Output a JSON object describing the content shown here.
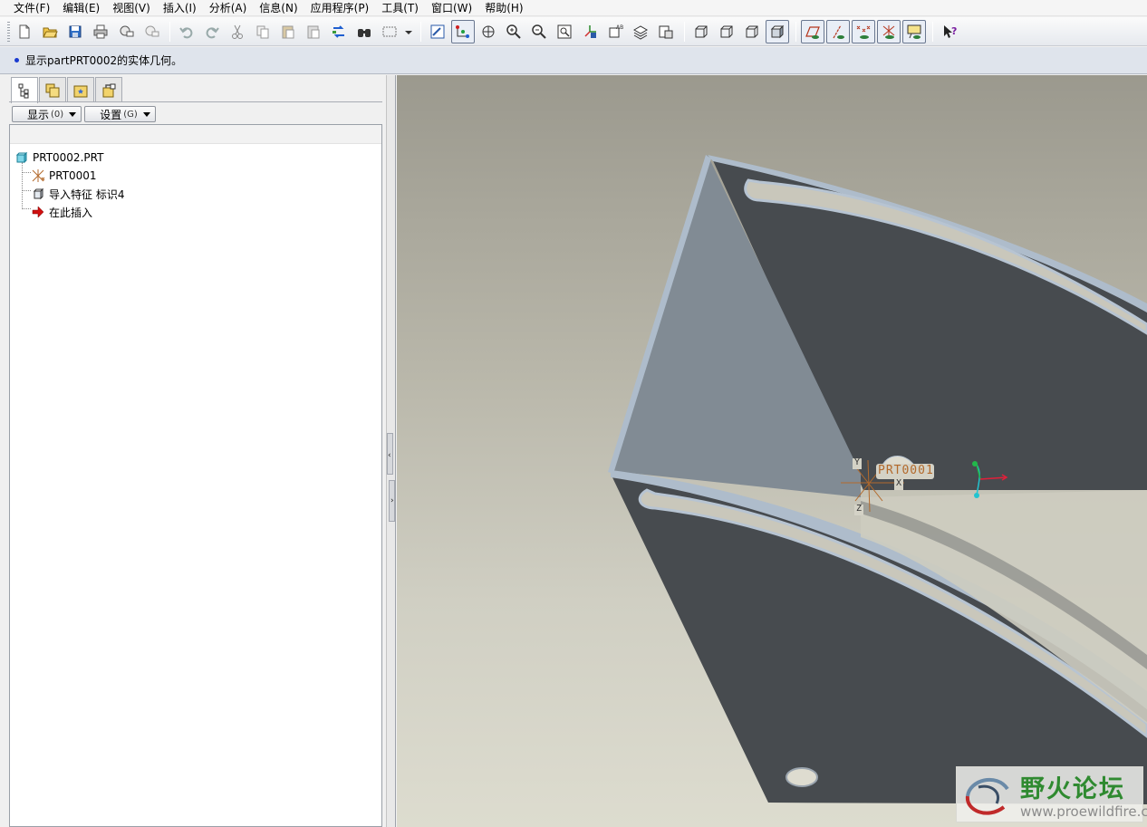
{
  "menu": {
    "items": [
      "文件(F)",
      "编辑(E)",
      "视图(V)",
      "插入(I)",
      "分析(A)",
      "信息(N)",
      "应用程序(P)",
      "工具(T)",
      "窗口(W)",
      "帮助(H)"
    ]
  },
  "toolbar": {
    "icons": [
      "new-file-icon",
      "open-folder-icon",
      "save-icon",
      "print-icon",
      "send-mail-icon",
      "mail-attach-icon",
      "undo-icon",
      "redo-icon",
      "cut-icon",
      "copy-icon",
      "paste-icon",
      "paste-special-icon",
      "regenerate-icon",
      "find-icon",
      "select-box-icon",
      "repaint-icon",
      "spin-center-icon",
      "orient-mode-icon",
      "zoom-in-icon",
      "zoom-out-icon",
      "refit-icon",
      "reorient-icon",
      "saved-views-icon",
      "layers-icon",
      "view-manager-icon",
      "wireframe-icon",
      "hidden-line-icon",
      "no-hidden-icon",
      "shading-icon",
      "datum-planes-icon",
      "datum-axes-icon",
      "datum-points-icon",
      "coordinate-systems-icon",
      "annotations-icon",
      "context-help-icon"
    ]
  },
  "message": {
    "text": "显示partPRT0002的实体几何。"
  },
  "left_panel": {
    "buttons": {
      "show_label": "显示",
      "show_accel": "(0)",
      "settings_label": "设置",
      "settings_accel": "(G)"
    },
    "tree": {
      "root": "PRT0002.PRT",
      "items": [
        {
          "label": "PRT0001",
          "icon": "coordinate-system-icon"
        },
        {
          "label": "导入特征 标识4",
          "icon": "import-feature-icon"
        },
        {
          "label": "在此插入",
          "icon": "insert-here-arrow-icon"
        }
      ]
    }
  },
  "graphics": {
    "csys_label": "PRT0001",
    "axis_labels": {
      "x": "X",
      "y": "Y",
      "z": "Z"
    },
    "colors": {
      "part_dark": "#474b4f",
      "part_light": "#818b94",
      "edge_highlight": "#aebccb",
      "csys": "#b36a2c",
      "triad_x": "#e0203a",
      "triad_y": "#22b84a",
      "triad_z": "#22c4d0"
    }
  },
  "watermark": {
    "title": "野火论坛",
    "url": "www.proewildfire.cn"
  }
}
